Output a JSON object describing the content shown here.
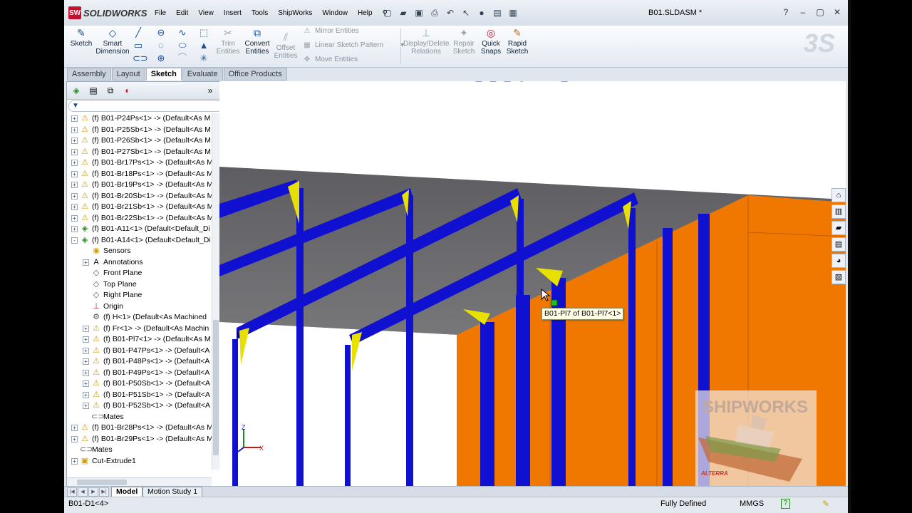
{
  "app": {
    "name": "SOLIDWORKS",
    "document_title": "B01.SLDASM *"
  },
  "menu": [
    "File",
    "Edit",
    "View",
    "Insert",
    "Tools",
    "ShipWorks",
    "Window",
    "Help"
  ],
  "commands": {
    "sketch": "Sketch",
    "smart_dimension": [
      "Smart",
      "Dimension"
    ],
    "trim_entities": [
      "Trim",
      "Entities"
    ],
    "convert_entities": [
      "Convert",
      "Entities"
    ],
    "offset_entities": [
      "Offset",
      "Entities"
    ],
    "mirror_entities": "Mirror Entities",
    "linear_sketch_pattern": "Linear Sketch Pattern",
    "move_entities": "Move Entities",
    "display_delete_relations": [
      "Display/Delete",
      "Relations"
    ],
    "repair_sketch": [
      "Repair",
      "Sketch"
    ],
    "quick_snaps": [
      "Quick",
      "Snaps"
    ],
    "rapid_sketch": [
      "Rapid",
      "Sketch"
    ]
  },
  "command_tabs": [
    "Assembly",
    "Layout",
    "Sketch",
    "Evaluate",
    "Office Products"
  ],
  "active_command_tab": "Sketch",
  "tree": [
    {
      "label": "(f) B01-P24Ps<1> -> (Default<As M",
      "level": 0,
      "icon": "part-warning-icon",
      "expand": "+"
    },
    {
      "label": "(f) B01-P25Sb<1> -> (Default<As M",
      "level": 0,
      "icon": "part-warning-icon",
      "expand": "+"
    },
    {
      "label": "(f) B01-P26Sb<1> -> (Default<As M",
      "level": 0,
      "icon": "part-warning-icon",
      "expand": "+"
    },
    {
      "label": "(f) B01-P27Sb<1> -> (Default<As M",
      "level": 0,
      "icon": "part-warning-icon",
      "expand": "+"
    },
    {
      "label": "(f) B01-Br17Ps<1> -> (Default<As M",
      "level": 0,
      "icon": "part-warning-icon",
      "expand": "+"
    },
    {
      "label": "(f) B01-Br18Ps<1> -> (Default<As M",
      "level": 0,
      "icon": "part-warning-icon",
      "expand": "+"
    },
    {
      "label": "(f) B01-Br19Ps<1> -> (Default<As M",
      "level": 0,
      "icon": "part-warning-icon",
      "expand": "+"
    },
    {
      "label": "(f) B01-Br20Sb<1> -> (Default<As M",
      "level": 0,
      "icon": "part-warning-icon",
      "expand": "+"
    },
    {
      "label": "(f) B01-Br21Sb<1> -> (Default<As M",
      "level": 0,
      "icon": "part-warning-icon",
      "expand": "+"
    },
    {
      "label": "(f) B01-Br22Sb<1> -> (Default<As M",
      "level": 0,
      "icon": "part-warning-icon",
      "expand": "+"
    },
    {
      "label": "(f) B01-A11<1> (Default<Default_Di",
      "level": 0,
      "icon": "assembly-icon",
      "expand": "+"
    },
    {
      "label": "(f) B01-A14<1> (Default<Default_Di",
      "level": 0,
      "icon": "assembly-icon",
      "expand": "-"
    },
    {
      "label": "Sensors",
      "level": 1,
      "icon": "sensors-icon",
      "expand": ""
    },
    {
      "label": "Annotations",
      "level": 1,
      "icon": "annotations-icon",
      "expand": "+"
    },
    {
      "label": "Front Plane",
      "level": 1,
      "icon": "plane-icon",
      "expand": ""
    },
    {
      "label": "Top Plane",
      "level": 1,
      "icon": "plane-icon",
      "expand": ""
    },
    {
      "label": "Right Plane",
      "level": 1,
      "icon": "plane-icon",
      "expand": ""
    },
    {
      "label": "Origin",
      "level": 1,
      "icon": "origin-icon",
      "expand": ""
    },
    {
      "label": "(f) H<1> (Default<As Machined",
      "level": 1,
      "icon": "hull-part-icon",
      "expand": ""
    },
    {
      "label": "(f) Fr<1> -> (Default<As Machin",
      "level": 1,
      "icon": "part-warning-icon",
      "expand": "+"
    },
    {
      "label": "(f) B01-Pl7<1> -> (Default<As M",
      "level": 1,
      "icon": "part-warning-icon",
      "expand": "+"
    },
    {
      "label": "(f) B01-P47Ps<1> -> (Default<A",
      "level": 1,
      "icon": "part-warning-icon",
      "expand": "+"
    },
    {
      "label": "(f) B01-P48Ps<1> -> (Default<A",
      "level": 1,
      "icon": "part-warning-icon",
      "expand": "+"
    },
    {
      "label": "(f) B01-P49Ps<1> -> (Default<A",
      "level": 1,
      "icon": "part-warning-icon",
      "expand": "+"
    },
    {
      "label": "(f) B01-P50Sb<1> -> (Default<A",
      "level": 1,
      "icon": "part-warning-icon",
      "expand": "+"
    },
    {
      "label": "(f) B01-P51Sb<1> -> (Default<A",
      "level": 1,
      "icon": "part-warning-icon",
      "expand": "+"
    },
    {
      "label": "(f) B01-P52Sb<1> -> (Default<A",
      "level": 1,
      "icon": "part-warning-icon",
      "expand": "+"
    },
    {
      "label": "Mates",
      "level": 1,
      "icon": "mates-icon",
      "expand": ""
    },
    {
      "label": "(f) B01-Br28Ps<1> -> (Default<As M",
      "level": 0,
      "icon": "part-warning-icon",
      "expand": "+"
    },
    {
      "label": "(f) B01-Br29Ps<1> -> (Default<As M",
      "level": 0,
      "icon": "part-warning-icon",
      "expand": "+"
    },
    {
      "label": "Mates",
      "level": 0,
      "icon": "mates-icon",
      "expand": ""
    },
    {
      "label": "Cut-Extrude1",
      "level": 0,
      "icon": "cut-extrude-icon",
      "expand": "+"
    }
  ],
  "bottom_tabs": [
    "Model",
    "Motion Study 1"
  ],
  "active_bottom_tab": "Model",
  "status": {
    "selection": "B01-D1<4>",
    "state": "Fully Defined",
    "units": "MMGS"
  },
  "viewport": {
    "tooltip": "B01-Pl7 of B01-Pl7<1>"
  },
  "watermark": {
    "title": "SHIPWORKS",
    "subtitle": "ALTERRA"
  },
  "triad": {
    "z": "Z",
    "x": "X"
  },
  "colors": {
    "beam": "#1010d0",
    "bracket": "#e8e000",
    "plate": "#f07800",
    "deck": "#6b6b6e",
    "background": "#ffffff"
  }
}
